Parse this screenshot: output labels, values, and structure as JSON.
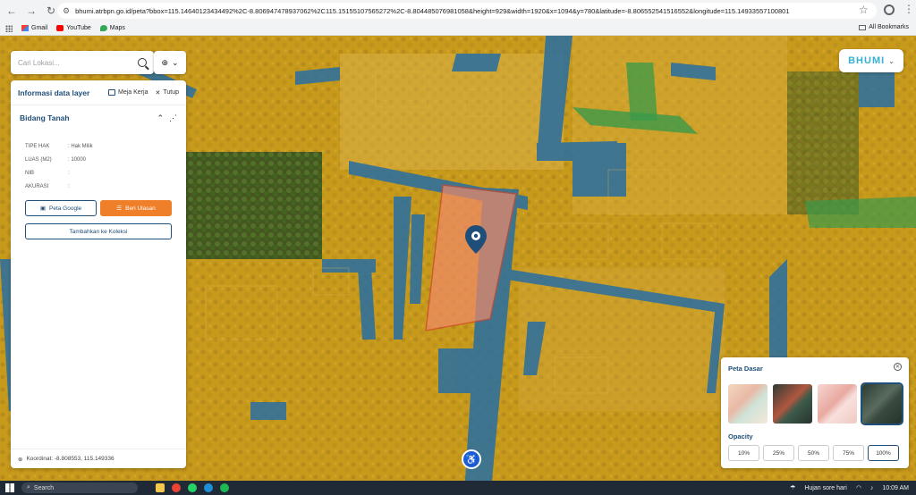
{
  "browser": {
    "url": "bhumi.atrbpn.go.id/peta?bbox=115.14640123434492%2C-8.806947478937062%2C115.15155107565272%2C-8.804485076981058&height=929&width=1920&x=1094&y=780&latitude=-8.806552541516552&longitude=115.14933557100801"
  },
  "bookmarks": {
    "items": [
      "Gmail",
      "YouTube",
      "Maps"
    ],
    "all": "All Bookmarks"
  },
  "search": {
    "placeholder": "Cari Lokasi..."
  },
  "panel": {
    "title": "Informasi data layer",
    "workspace": "Meja Kerja",
    "close": "Tutup",
    "section": "Bidang Tanah",
    "rows": [
      {
        "k": "TIPE HAK",
        "v": ": Hak Milik"
      },
      {
        "k": "LUAS (M2)",
        "v": ": 10000"
      },
      {
        "k": "NIB",
        "v": ":"
      },
      {
        "k": "AKURASI",
        "v": ":"
      }
    ],
    "btn_google": "Peta Google",
    "btn_review": "Beri Ulasan",
    "btn_add": "Tambahkan ke Koleksi",
    "coordinate": "Koordinat: -8.808553, 115.149336"
  },
  "logo": {
    "text": "BHUMI"
  },
  "basemap": {
    "title": "Peta Dasar",
    "opacity_title": "Opacity",
    "opacities": [
      "10%",
      "25%",
      "50%",
      "75%",
      "100%"
    ],
    "selected_opacity": "100%"
  },
  "taskbar": {
    "search": "Search",
    "weather": "Hujan sore hari",
    "time": "10:09 AM"
  },
  "colors": {
    "brand": "#35b1d2",
    "panel_title": "#1f4e79",
    "orange_button": "#f07f2a",
    "parcel_highlight": "#f08a6a"
  }
}
